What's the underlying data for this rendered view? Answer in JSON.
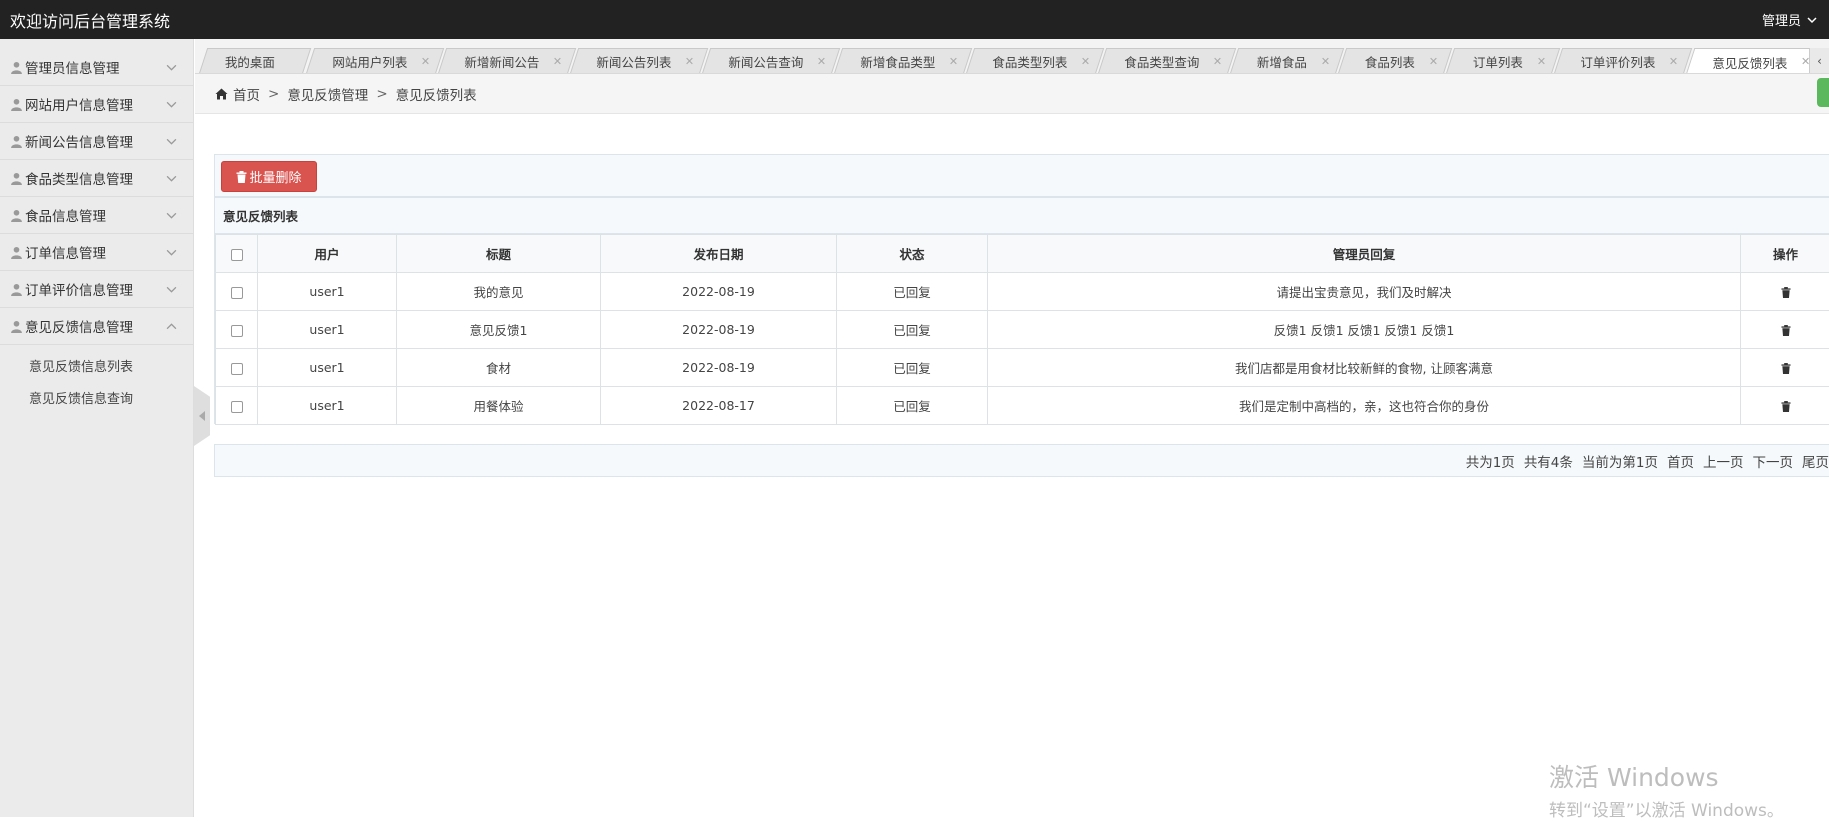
{
  "header": {
    "title": "欢迎访问后台管理系统",
    "user_label": "管理员"
  },
  "sidebar": {
    "items": [
      {
        "label": "管理员信息管理"
      },
      {
        "label": "网站用户信息管理"
      },
      {
        "label": "新闻公告信息管理"
      },
      {
        "label": "食品类型信息管理"
      },
      {
        "label": "食品信息管理"
      },
      {
        "label": "订单信息管理"
      },
      {
        "label": "订单评价信息管理"
      },
      {
        "label": "意见反馈信息管理"
      }
    ],
    "subitems": [
      {
        "label": "意见反馈信息列表"
      },
      {
        "label": "意见反馈信息查询"
      }
    ]
  },
  "tabs": [
    {
      "label": "我的桌面"
    },
    {
      "label": "网站用户列表"
    },
    {
      "label": "新增新闻公告"
    },
    {
      "label": "新闻公告列表"
    },
    {
      "label": "新闻公告查询"
    },
    {
      "label": "新增食品类型"
    },
    {
      "label": "食品类型列表"
    },
    {
      "label": "食品类型查询"
    },
    {
      "label": "新增食品"
    },
    {
      "label": "食品列表"
    },
    {
      "label": "订单列表"
    },
    {
      "label": "订单评价列表"
    },
    {
      "label": "意见反馈列表"
    }
  ],
  "breadcrumb": {
    "home": "首页",
    "section": "意见反馈管理",
    "page": "意见反馈列表"
  },
  "toolbar": {
    "batch_delete_label": "批量删除"
  },
  "list": {
    "title": "意见反馈列表",
    "columns": [
      "用户",
      "标题",
      "发布日期",
      "状态",
      "管理员回复",
      "操作"
    ],
    "rows": [
      {
        "user": "user1",
        "title": "我的意见",
        "date": "2022-08-19",
        "status": "已回复",
        "reply": "请提出宝贵意见，我们及时解决"
      },
      {
        "user": "user1",
        "title": "意见反馈1",
        "date": "2022-08-19",
        "status": "已回复",
        "reply": "反馈1 反馈1 反馈1 反馈1 反馈1"
      },
      {
        "user": "user1",
        "title": "食材",
        "date": "2022-08-19",
        "status": "已回复",
        "reply": "我们店都是用食材比较新鲜的食物, 让顾客满意"
      },
      {
        "user": "user1",
        "title": "用餐体验",
        "date": "2022-08-17",
        "status": "已回复",
        "reply": "我们是定制中高档的，亲，这也符合你的身份"
      }
    ]
  },
  "pager": {
    "total_pages": "共为1页",
    "total_count": "共有4条",
    "current": "当前为第1页",
    "first": "首页",
    "prev": "上一页",
    "next": "下一页",
    "last": "尾页"
  },
  "watermark": {
    "line1": "激活 Windows",
    "line2": "转到“设置”以激活 Windows。"
  }
}
